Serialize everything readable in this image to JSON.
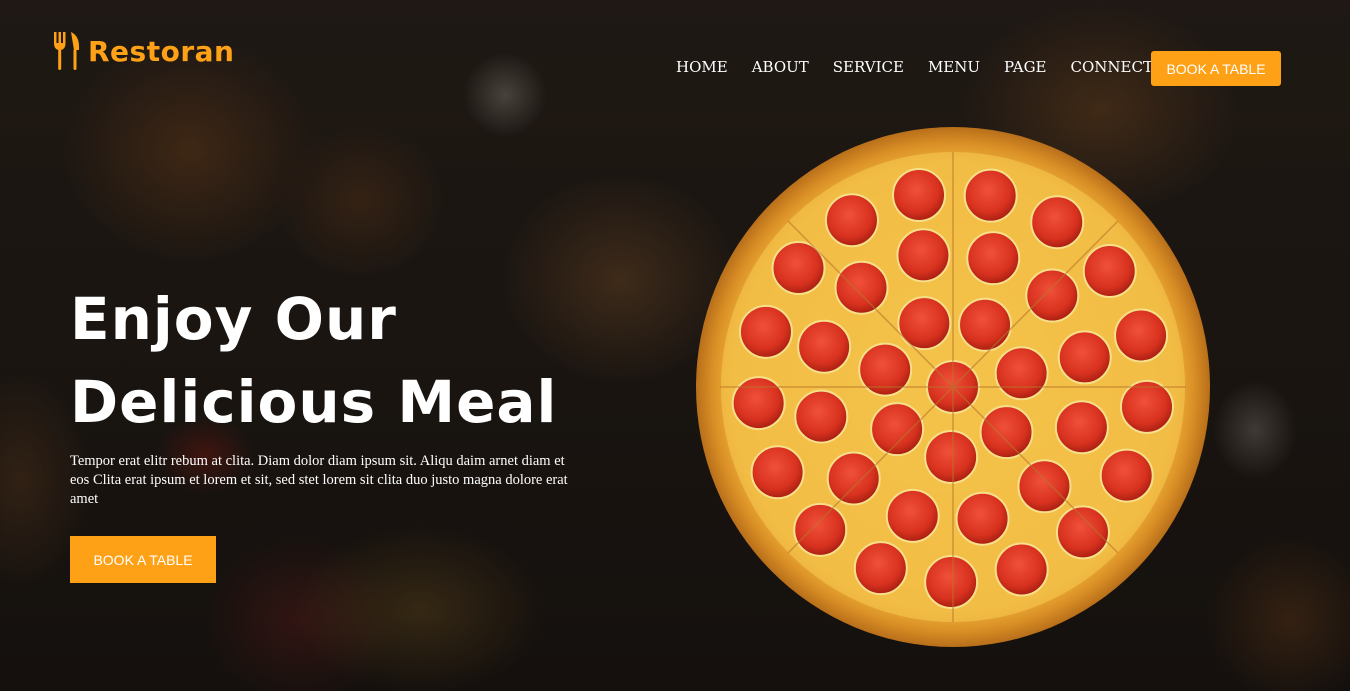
{
  "brand": {
    "name": "Restoran",
    "icon": "fork-knife-icon",
    "color": "#FEA116"
  },
  "nav": {
    "items": [
      "HOME",
      "ABOUT",
      "SERVICE",
      "MENU",
      "PAGE",
      "CONNECT"
    ],
    "cta_label": "BOOK A TABLE"
  },
  "hero": {
    "title_line1": "Enjoy Our",
    "title_line2": "Delicious Meal",
    "text": "Tempor erat elitr rebum at clita. Diam dolor diam ipsum sit. Aliqu daim arnet diam et eos Clita erat ipsum et lorem et sit, sed stet lorem sit clita duo justo magna dolore erat amet",
    "cta_label": "BOOK A TABLE"
  },
  "colors": {
    "accent": "#FEA116",
    "text": "#FFFFFF"
  }
}
